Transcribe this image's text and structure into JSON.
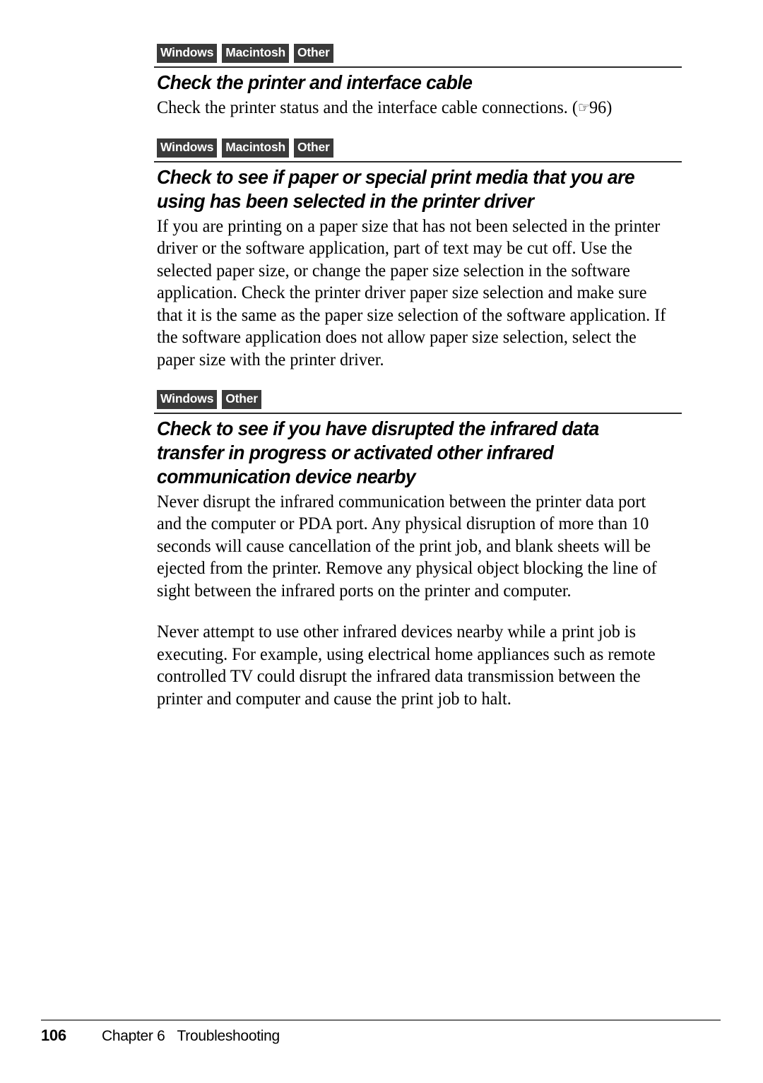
{
  "page": {
    "number": "106",
    "chapter": "Chapter 6",
    "chapter_title": "Troubleshooting"
  },
  "sections": [
    {
      "badges": [
        "Windows",
        "Macintosh",
        "Other"
      ],
      "heading": "Check the printer and interface cable",
      "body_pre": "Check the printer status and the interface cable connections. (",
      "ref_icon": "☞",
      "ref_page": "96",
      "body_post": ")",
      "paragraphs": []
    },
    {
      "badges": [
        "Windows",
        "Macintosh",
        "Other"
      ],
      "heading": "Check to see if paper or special print media that you are using has been selected in the printer driver",
      "paragraphs": [
        "If you are printing on a paper size that has not been selected in the printer driver or the software application, part of text may be cut off. Use the selected paper size, or change the paper size selection in the software application. Check the printer driver paper size selection and make sure that it is the same as the paper size selection of the software application. If the software application does not allow paper size selection, select the paper size with the printer driver."
      ]
    },
    {
      "badges": [
        "Windows",
        "Other"
      ],
      "heading": "Check to see if you have disrupted the infrared data transfer in progress or activated other infrared communication device nearby",
      "paragraphs": [
        "Never disrupt the infrared communication between the printer data port and the computer or PDA port.  Any physical disruption of more than 10 seconds will cause cancellation of the print job, and blank sheets will be ejected from the printer.  Remove any physical object blocking the line of sight between the infrared ports on the printer and computer.",
        "Never attempt to use other infrared devices nearby while a print job is executing.  For example, using electrical home appliances such as remote controlled TV could disrupt the infrared data transmission between the printer and computer and cause the print job to halt."
      ]
    }
  ],
  "colors": {
    "badge_background": "#3a3a3a",
    "badge_text": "#ffffff",
    "rule": "#2b2b2b",
    "footer_rule": "#6e6e6e",
    "text": "#000000",
    "page_background": "#ffffff"
  }
}
